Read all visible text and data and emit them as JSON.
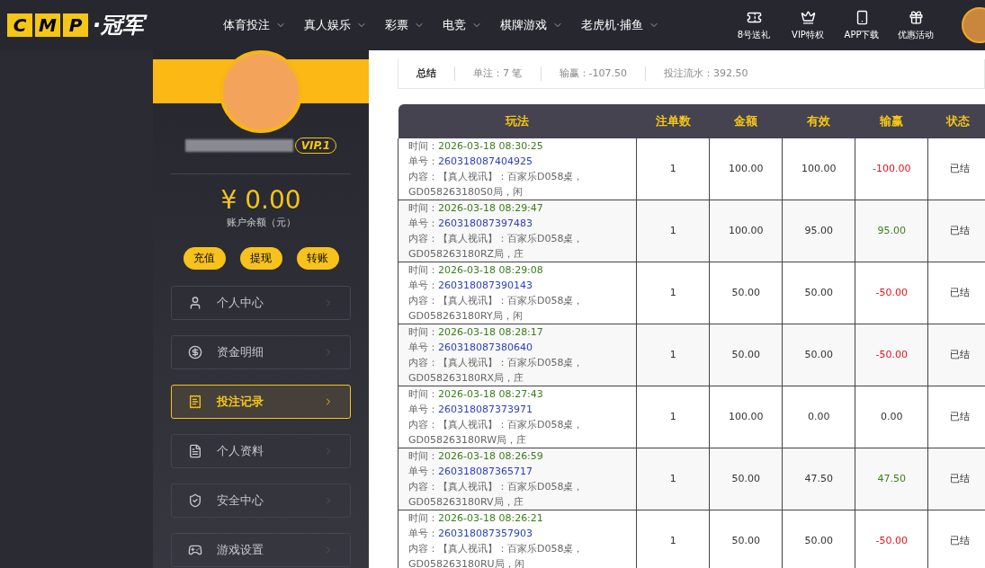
{
  "logo": {
    "letters": [
      "C",
      "M",
      "P"
    ],
    "name": "·冠军"
  },
  "nav": [
    {
      "label": "体育投注"
    },
    {
      "label": "真人娱乐"
    },
    {
      "label": "彩票"
    },
    {
      "label": "电竞"
    },
    {
      "label": "棋牌游戏"
    },
    {
      "label": "老虎机·捕鱼"
    }
  ],
  "header_actions": [
    {
      "kind": "ticket",
      "label": "8号送礼"
    },
    {
      "kind": "crown",
      "label": "VIP特权"
    },
    {
      "kind": "phone",
      "label": "APP下载"
    },
    {
      "kind": "gift",
      "label": "优惠活动"
    }
  ],
  "profile": {
    "vip": "VIP.1",
    "balance": "¥ 0.00",
    "balance_label": "账户余额（元）",
    "actions": [
      "充值",
      "提现",
      "转账"
    ]
  },
  "menu": [
    {
      "kind": "user",
      "label": "个人中心",
      "selected": false
    },
    {
      "kind": "money",
      "label": "资金明细",
      "selected": false
    },
    {
      "kind": "record",
      "label": "投注记录",
      "selected": true
    },
    {
      "kind": "doc",
      "label": "个人资料",
      "selected": false
    },
    {
      "kind": "shield",
      "label": "安全中心",
      "selected": false
    },
    {
      "kind": "game",
      "label": "游戏设置",
      "selected": false
    }
  ],
  "summary": {
    "title": "总结",
    "items": [
      "单注：7 笔",
      "输赢：-107.50",
      "投注流水：392.50"
    ]
  },
  "table": {
    "columns": [
      "玩法",
      "注单数",
      "金额",
      "有效",
      "输赢",
      "状态"
    ],
    "rows": [
      {
        "time_label": "时间：",
        "time": "2026-03-18 08:30:25",
        "order_label": "单号：",
        "order": "260318087404925",
        "content": "内容：【真人视讯】：百家乐D058桌，GD058263180S0局，闲",
        "count": "1",
        "amount": "100.00",
        "valid": "100.00",
        "result": "-100.00",
        "kind": "loss",
        "status": "已结"
      },
      {
        "time_label": "时间：",
        "time": "2026-03-18 08:29:47",
        "order_label": "单号：",
        "order": "260318087397483",
        "content": "内容：【真人视讯】：百家乐D058桌，GD058263180RZ局，庄",
        "count": "1",
        "amount": "100.00",
        "valid": "95.00",
        "result": "95.00",
        "kind": "win",
        "status": "已结"
      },
      {
        "time_label": "时间：",
        "time": "2026-03-18 08:29:08",
        "order_label": "单号：",
        "order": "260318087390143",
        "content": "内容：【真人视讯】：百家乐D058桌，GD058263180RY局，闲",
        "count": "1",
        "amount": "50.00",
        "valid": "50.00",
        "result": "-50.00",
        "kind": "loss",
        "status": "已结"
      },
      {
        "time_label": "时间：",
        "time": "2026-03-18 08:28:17",
        "order_label": "单号：",
        "order": "260318087380640",
        "content": "内容：【真人视讯】：百家乐D058桌，GD058263180RX局，庄",
        "count": "1",
        "amount": "50.00",
        "valid": "50.00",
        "result": "-50.00",
        "kind": "loss",
        "status": "已结"
      },
      {
        "time_label": "时间：",
        "time": "2026-03-18 08:27:43",
        "order_label": "单号：",
        "order": "260318087373971",
        "content": "内容：【真人视讯】：百家乐D058桌，GD058263180RW局，庄",
        "count": "1",
        "amount": "100.00",
        "valid": "0.00",
        "result": "0.00",
        "kind": "even",
        "status": "已结"
      },
      {
        "time_label": "时间：",
        "time": "2026-03-18 08:26:59",
        "order_label": "单号：",
        "order": "260318087365717",
        "content": "内容：【真人视讯】：百家乐D058桌，GD058263180RV局，庄",
        "count": "1",
        "amount": "50.00",
        "valid": "47.50",
        "result": "47.50",
        "kind": "win",
        "status": "已结"
      },
      {
        "time_label": "时间：",
        "time": "2026-03-18 08:26:21",
        "order_label": "单号：",
        "order": "260318087357903",
        "content": "内容：【真人视讯】：百家乐D058桌，GD058263180RU局，闲",
        "count": "1",
        "amount": "50.00",
        "valid": "50.00",
        "result": "-50.00",
        "kind": "loss",
        "status": "已结"
      }
    ]
  }
}
